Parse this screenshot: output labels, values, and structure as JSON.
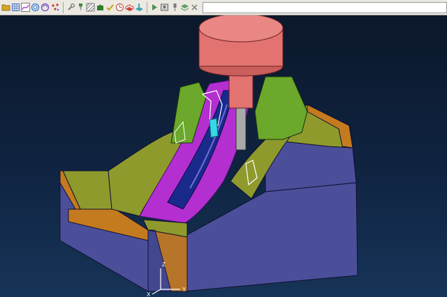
{
  "toolbar": {
    "buttons": [
      {
        "icon": "folder-icon",
        "color": "#d9a52b"
      },
      {
        "icon": "grid-icon",
        "color": "#4a6fb5"
      },
      {
        "icon": "toolpath-icon",
        "color": "#b040c0"
      },
      {
        "icon": "spiral-icon",
        "color": "#3a7bd5"
      },
      {
        "icon": "spiral-icon",
        "color": "#6b4bc0"
      },
      {
        "icon": "points-icon",
        "color": "#cc3333"
      },
      {
        "icon": "wrench-icon",
        "color": "#7a7a7a"
      },
      {
        "icon": "drill-icon",
        "color": "#3c8c3c"
      },
      {
        "icon": "hatch-icon",
        "color": "#7a7a7a"
      },
      {
        "icon": "puzzle-icon",
        "color": "#2f7f2f"
      },
      {
        "icon": "verify-icon",
        "color": "#c0a000"
      },
      {
        "icon": "clock-icon",
        "color": "#c04040"
      },
      {
        "icon": "stock-icon",
        "color": "#d04040"
      },
      {
        "icon": "stock-icon",
        "color": "#3aa3b3"
      },
      {
        "icon": "sim-icon",
        "color": "#4f8f4f"
      },
      {
        "icon": "machine-icon",
        "color": "#6b6b6b"
      },
      {
        "icon": "tool-icon",
        "color": "#7b7b7b"
      },
      {
        "icon": "layers-icon",
        "color": "#5fa05f"
      },
      {
        "icon": "close-icon",
        "color": "#777777"
      }
    ]
  },
  "viewport": {
    "background": "#0f2340",
    "axes": {
      "x_label": "X",
      "y_label": "Y",
      "z_label": "Z"
    },
    "colors": {
      "spindle": "#e27370",
      "mold_side": "#4b4f9a",
      "mold_top": "#8f9a2d",
      "mold_edge": "#c47a1e",
      "cavity": "#b42fd0",
      "channel": "#1a2a8c",
      "guide_green": "#6ba82b",
      "toolpath": "#ffffff",
      "tool_highlight": "#35d9e6"
    }
  }
}
